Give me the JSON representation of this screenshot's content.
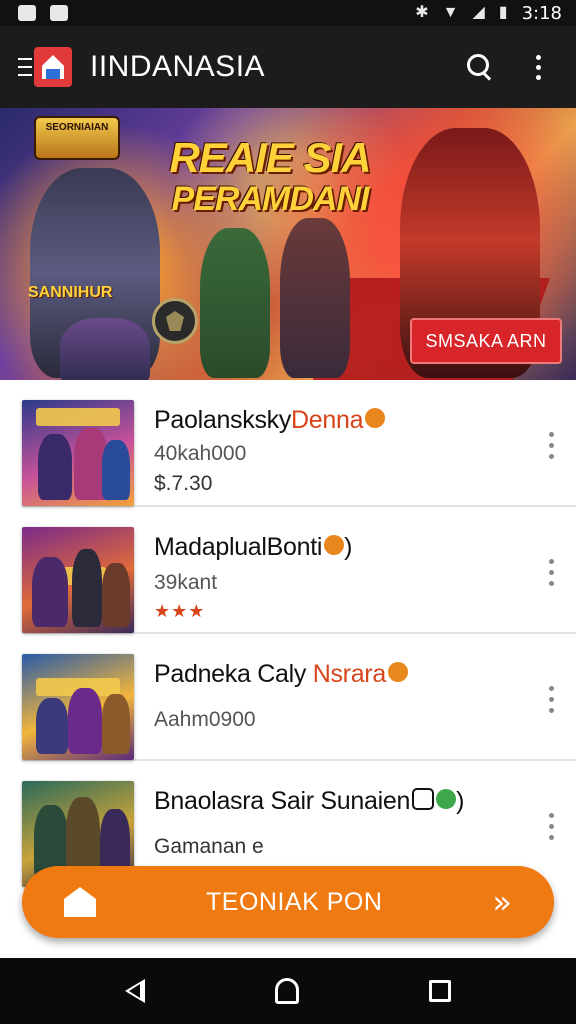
{
  "status_bar": {
    "time": "3:18",
    "left_icons": [
      "notification-icon",
      "message-icon"
    ],
    "right_icons": [
      "bug-icon",
      "wifi-icon",
      "signal-icon",
      "battery-icon"
    ]
  },
  "app_bar": {
    "title": "IINDANASIA",
    "menu_icon": "menu-icon",
    "logo": "app-logo",
    "actions": [
      "search-icon",
      "more-vert-icon"
    ]
  },
  "banner": {
    "badge_text": "SEORNIAIAN",
    "title_line1": "REAIE SIA",
    "title_line2": "PERAMDANI",
    "sub_text": "SANNIHUR",
    "cta_label": "SMSAKA ARN"
  },
  "list": {
    "items": [
      {
        "title_main": "Paolansksky",
        "title_accent": "Denna",
        "badge": "orange",
        "subtitle": "40kah000",
        "meta": "$.7.30",
        "thumb_colors": [
          "#2a3a8a",
          "#c8529a",
          "#f2a13a"
        ]
      },
      {
        "title_main": "MadaplualBonti",
        "title_accent": "",
        "badge": "orange",
        "title_suffix": ")",
        "subtitle": "39kant",
        "meta": "",
        "stars": "★★★",
        "thumb_colors": [
          "#7a2a8a",
          "#e06a3a",
          "#3a2a5a"
        ]
      },
      {
        "title_main": "Padneka Caly",
        "title_accent": "Nsrara",
        "badge": "orange",
        "subtitle": "Aahm0900",
        "meta": "",
        "thumb_colors": [
          "#2a5aa8",
          "#f2b63a",
          "#5a2a7a"
        ]
      },
      {
        "title_main": "Bnaolasra Sair Sunaien",
        "title_accent": "",
        "badge": "boxed-green",
        "title_suffix": ")",
        "subtitle": "Gamanan e",
        "meta": "",
        "thumb_colors": [
          "#2a6a5a",
          "#c8a33a",
          "#3a2a4a"
        ]
      }
    ]
  },
  "bottom_action": {
    "label": "TEONIAK PON",
    "left_icon": "home-icon",
    "right_icon": "forward-icon",
    "color": "#f07a12"
  },
  "system_nav": {
    "icons": [
      "back-icon",
      "home-icon",
      "recents-icon"
    ]
  },
  "colors": {
    "app_bar_bg": "#1c1c1c",
    "accent_orange": "#f07a12",
    "accent_red": "#d8441a",
    "cta_red": "#d7252a"
  }
}
